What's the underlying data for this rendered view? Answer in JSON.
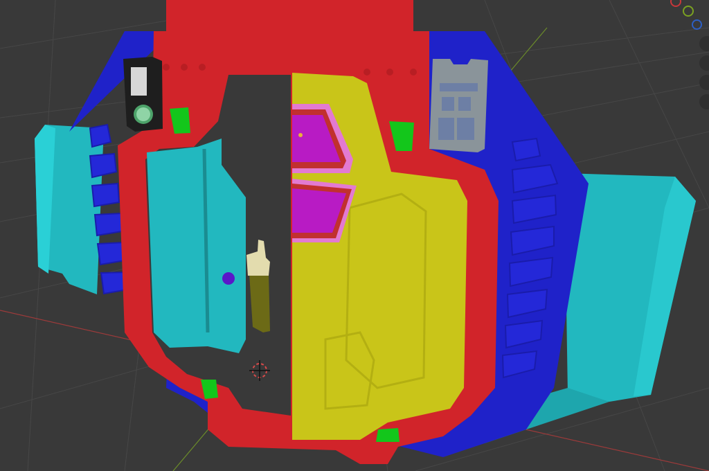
{
  "app": {
    "name": "3D viewport"
  },
  "viewport": {
    "background": "#393939",
    "grid_color": "#4a4a4a"
  },
  "axes": {
    "x_axis_color": "#9c3a3a",
    "y_axis_color": "#6b8c2a"
  },
  "model": {
    "frame_color": "#d1242a",
    "body_color": "#1f22c9",
    "side_wing_color": "#22b8bf",
    "door_color": "#c9c519",
    "inner_panel_color": "#22b8bf",
    "window_color": "#b81bc4",
    "marker_color": "#13c61b",
    "hinge_color": "#e3dcae",
    "hinge_base_color": "#6c6a16",
    "dot_color": "#5a17c9",
    "small_panel_color": "#8a949a",
    "dark_module_color": "#1e1e1e"
  },
  "gizmo": {
    "x_color": "#c9373a",
    "y_color": "#7ba221",
    "z_color": "#2d5fc4"
  },
  "cursor_icon": "3d-cursor-icon"
}
